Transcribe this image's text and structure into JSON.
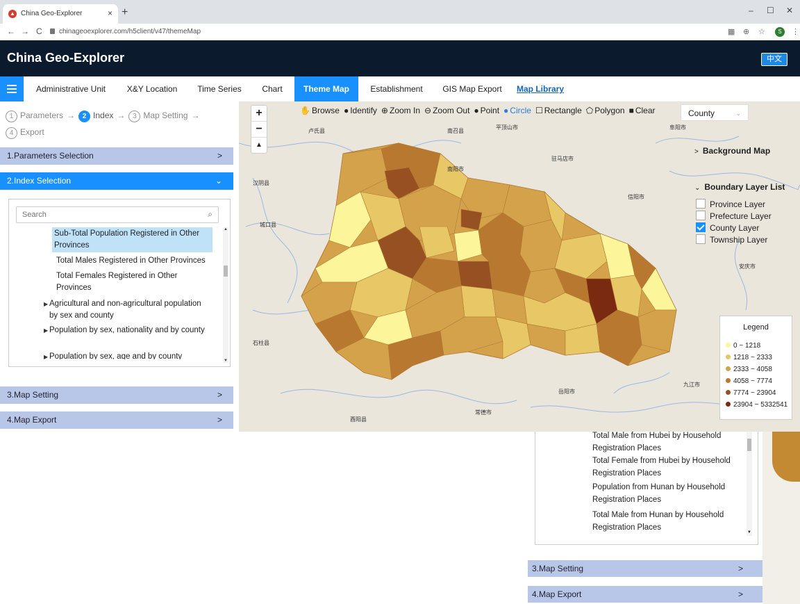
{
  "browser": {
    "tab_title": "China Geo-Explorer",
    "tab_close": "×",
    "new_tab": "+",
    "url": "chinageoexplorer.com/h5client/v47/themeMap",
    "win_min": "–",
    "win_max": "☐",
    "win_close": "✕",
    "profile_initial": "S"
  },
  "app": {
    "title": "China Geo-Explorer",
    "lang_button": "中文"
  },
  "nav": {
    "items": [
      {
        "label": "Administrative Unit"
      },
      {
        "label": "X&Y Location"
      },
      {
        "label": "Time Series"
      },
      {
        "label": "Chart"
      },
      {
        "label": "Theme Map"
      },
      {
        "label": "Establishment"
      },
      {
        "label": "GIS Map Export"
      },
      {
        "label": "Map Library"
      }
    ]
  },
  "steps": {
    "s1_num": "1",
    "s1": "Parameters",
    "s2_num": "2",
    "s2": "Index",
    "s3_num": "3",
    "s3": "Map Setting",
    "s4_num": "4",
    "s4": "Export",
    "arrow": "→"
  },
  "accordion": {
    "a1": "1.Parameters Selection",
    "a2": "2.Index Selection",
    "a3": "3.Map Setting",
    "a4": "4.Map Export"
  },
  "index_search": {
    "placeholder": "Search"
  },
  "index_tree": {
    "i1": "Sub-Total Population Registered in Other Provinces",
    "i2": "Total Males Registered in Other Provinces",
    "i3": "Total Females Registered in Other Provinces",
    "g1": "Agricultural and non-agricultural population by sex and county",
    "g2": "Population by sex, nationality and by county",
    "g3": "Population by sex, age and by county"
  },
  "toolbar": {
    "browse": "Browse",
    "identify": "Identify",
    "zoom_in": "Zoom In",
    "zoom_out": "Zoom Out",
    "point": "Point",
    "circle": "Circle",
    "rectangle": "Rectangle",
    "polygon": "Polygon",
    "clear": "Clear",
    "level": "County"
  },
  "zoom": {
    "plus": "+",
    "minus": "−"
  },
  "layers": {
    "background_map": "Background Map",
    "boundary_list": "Boundary Layer List",
    "province": "Province Layer",
    "prefecture": "Prefecture Layer",
    "county": "County Layer",
    "township": "Township Layer",
    "county_checked": true
  },
  "legend": {
    "title": "Legend",
    "classes": [
      {
        "label": "0 ~ 1218",
        "color": "#fdf59a"
      },
      {
        "label": "1218 ~ 2333",
        "color": "#e8c766"
      },
      {
        "label": "2333 ~ 4058",
        "color": "#d4a24a"
      },
      {
        "label": "4058 ~ 7774",
        "color": "#b9782f"
      },
      {
        "label": "7774 ~ 23904",
        "color": "#975021"
      },
      {
        "label": "23904 ~ 5332541",
        "color": "#7a2a10"
      }
    ]
  },
  "inset": {
    "items": [
      "Total Male from Hubei by Household Registration Places",
      "Total Female from Hubei by Household Registration Places",
      "Population from Hunan by Household Registration Places",
      "Total Male from Hunan by Household Registration Places"
    ],
    "map_setting": "3.Map Setting",
    "map_export": "4.Map Export"
  },
  "colors": {
    "accent": "#1890ff",
    "header_bg": "#0c1a2e",
    "accordion_bg": "#b8c7e8"
  }
}
